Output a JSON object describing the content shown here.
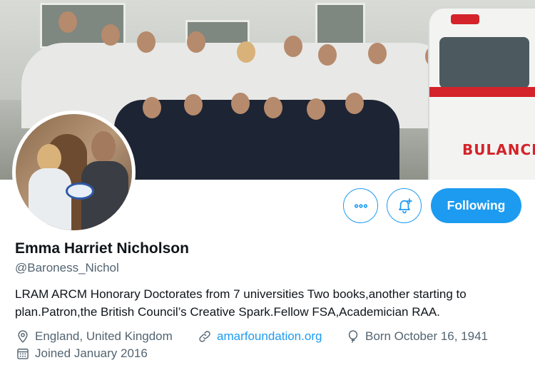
{
  "profile": {
    "name": "Emma Harriet Nicholson",
    "handle": "@Baroness_Nichol",
    "bio": "LRAM ARCM Honorary Doctorates from 7 universities Two books,another starting to plan.Patron,the British Council’s Creative Spark.Fellow FSA,Academician RAA.",
    "location": "England, United Kingdom",
    "website": "amarfoundation.org",
    "birthday": "Born October 16, 1941",
    "joined": "Joined January 2016"
  },
  "banner": {
    "ambulance_text": "BULANCE"
  },
  "actions": {
    "more_icon": "more-icon",
    "notify_icon": "bell-plus-icon",
    "follow_label": "Following"
  },
  "colors": {
    "accent": "#1d9bf0",
    "text_primary": "#0f1419",
    "text_secondary": "#536471"
  }
}
